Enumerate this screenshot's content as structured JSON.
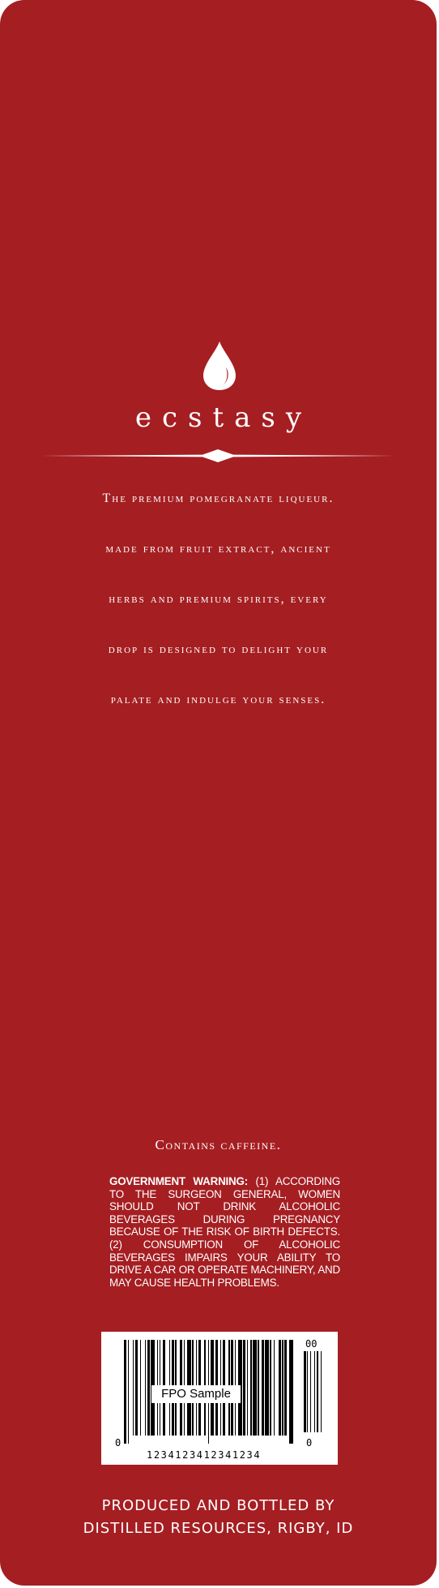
{
  "label": {
    "background_color": "#a51e22",
    "text_color": "#ffffff",
    "emblem_icon": "drop-icon",
    "brand": "ecstasy",
    "tagline_lines": [
      "The premium pomegranate liqueur.",
      "made from fruit extract, ancient",
      "herbs and premium spirits, every",
      "drop is designed to delight your",
      "palate and indulge your senses."
    ],
    "caffeine_note": "Contains caffeine.",
    "warning": {
      "title": "GOVERNMENT WARNING:",
      "body": " (1) ACCORDING TO THE SURGEON GENERAL, WOMEN SHOULD NOT DRINK ALCOHOLIC BEVERAGES DURING PREGNANCY BECAUSE OF  THE RISK OF BIRTH DEFECTS. (2) CONSUMPTION OF ALCOHOLIC BEVERAGES IMPAIRS YOUR ABILITY TO DRIVE A CAR OR OPERATE MACHINERY, AND MAY CAUSE HEALTH PROBLEMS."
    },
    "barcode": {
      "overlay_text": "FPO Sample",
      "number": "1234123412341234",
      "left_digit": "0",
      "right_digit": "0",
      "addon_digits": "00"
    },
    "producer_lines": [
      "Produced and bottled by",
      "Distilled Resources, Rigby, ID"
    ]
  }
}
